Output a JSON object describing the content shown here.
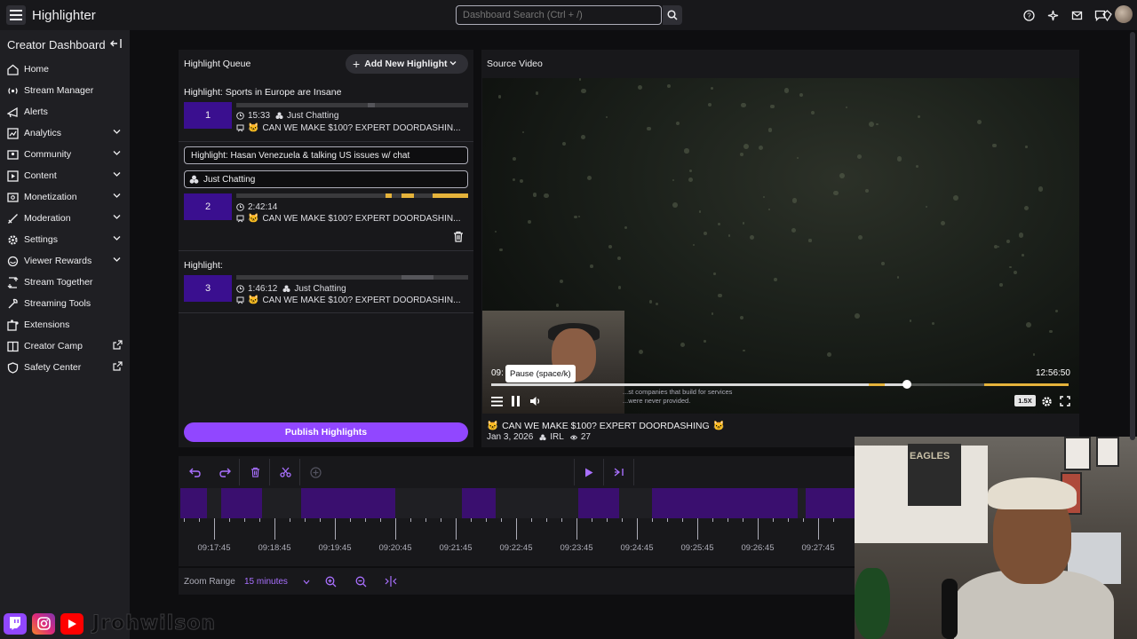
{
  "topbar": {
    "app_title": "Highlighter",
    "search_placeholder": "Dashboard Search (Ctrl + /)",
    "icons": [
      "menu-icon",
      "search-icon",
      "help-icon",
      "magic-icon",
      "inbox-icon",
      "chat-icon",
      "bits-icon",
      "avatar"
    ]
  },
  "sidebar": {
    "title": "Creator Dashboard",
    "items": [
      {
        "label": "Home",
        "icon": "home-icon",
        "expandable": false,
        "external": false
      },
      {
        "label": "Stream Manager",
        "icon": "stream-icon",
        "expandable": false,
        "external": false
      },
      {
        "label": "Alerts",
        "icon": "alert-icon",
        "expandable": false,
        "external": false
      },
      {
        "label": "Analytics",
        "icon": "analytics-icon",
        "expandable": true,
        "external": false
      },
      {
        "label": "Community",
        "icon": "community-icon",
        "expandable": true,
        "external": false
      },
      {
        "label": "Content",
        "icon": "content-icon",
        "expandable": true,
        "external": false
      },
      {
        "label": "Monetization",
        "icon": "money-icon",
        "expandable": true,
        "external": false
      },
      {
        "label": "Moderation",
        "icon": "sword-icon",
        "expandable": true,
        "external": false
      },
      {
        "label": "Settings",
        "icon": "gear-icon",
        "expandable": true,
        "external": false
      },
      {
        "label": "Viewer Rewards",
        "icon": "reward-icon",
        "expandable": true,
        "external": false
      },
      {
        "label": "Stream Together",
        "icon": "together-icon",
        "expandable": false,
        "external": false
      },
      {
        "label": "Streaming Tools",
        "icon": "tools-icon",
        "expandable": false,
        "external": false
      },
      {
        "label": "Extensions",
        "icon": "extension-icon",
        "expandable": false,
        "external": false
      },
      {
        "label": "Creator Camp",
        "icon": "camp-icon",
        "expandable": false,
        "external": true
      },
      {
        "label": "Safety Center",
        "icon": "shield-icon",
        "expandable": false,
        "external": true
      }
    ]
  },
  "queue": {
    "title": "Highlight Queue",
    "add_button": "Add New Highlight",
    "highlights": [
      {
        "number": "1",
        "title": "Highlight: Sports in Europe are Insane",
        "duration": "15:33",
        "category": "Just Chatting",
        "source": "CAN WE MAKE $100? EXPERT DOORDASHIN..."
      },
      {
        "number": "2",
        "title": "Highlight: Hasan Venezuela & talking US issues w/ chat",
        "duration": "2:42:14",
        "category": "Just Chatting",
        "source": "CAN WE MAKE $100? EXPERT DOORDASHIN..."
      },
      {
        "number": "3",
        "title": "Highlight:",
        "duration": "1:46:12",
        "category": "Just Chatting",
        "source": "CAN WE MAKE $100? EXPERT DOORDASHIN..."
      }
    ],
    "publish_button": "Publish Highlights"
  },
  "source_video": {
    "title": "Source Video",
    "current_time": "09:",
    "end_time": "12:56:50",
    "progress_fraction": 0.72,
    "tooltip": "Pause (space/k)",
    "caption_line1": "...st companies that build for services",
    "caption_line2": "...were never provided.",
    "speed": "1.5X",
    "stream_title": "CAN WE MAKE $100? EXPERT DOORDASHING",
    "date": "Jan 3, 2026",
    "category": "IRL",
    "viewers": "27"
  },
  "timeline": {
    "tick_labels": [
      "09:17:45",
      "09:18:45",
      "09:19:45",
      "09:20:45",
      "09:21:45",
      "09:22:45",
      "09:23:45",
      "09:24:45",
      "09:25:45",
      "09:26:45",
      "09:27:45"
    ],
    "zoom_label": "Zoom Range",
    "zoom_value": "15 minutes"
  },
  "webcam": {
    "poster_text": "EAGLES"
  },
  "overlay": {
    "handle": "Jrohwilson",
    "social_icons": [
      "twitch-icon",
      "instagram-icon",
      "youtube-icon"
    ]
  },
  "colors": {
    "accent": "#9147ff",
    "highlight_block": "#3a0f8f",
    "segment_marker": "#e5b33b",
    "background": "#0e0e10",
    "panel": "#18181b"
  }
}
